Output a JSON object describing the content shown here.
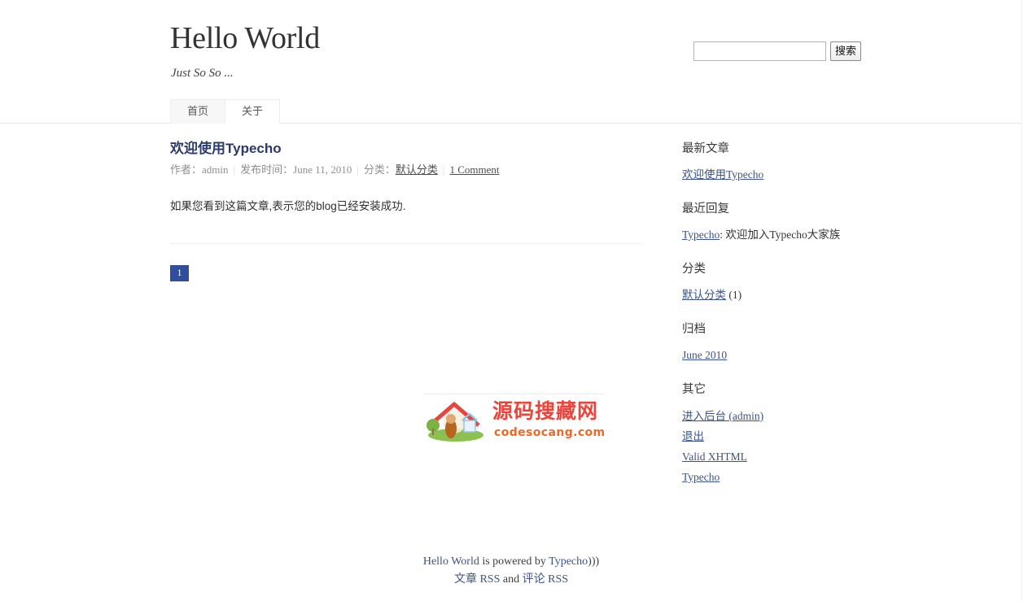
{
  "site": {
    "title": "Hello World",
    "description": "Just So So ..."
  },
  "search": {
    "value": "",
    "placeholder": "",
    "button_label": "搜索"
  },
  "nav": {
    "items": [
      {
        "label": "首页",
        "current": true
      },
      {
        "label": "关于",
        "current": false
      }
    ]
  },
  "post": {
    "title": "欢迎使用Typecho",
    "meta": {
      "author_label": "作者：",
      "author": "admin",
      "date_label": "发布时间：",
      "date": "June 11, 2010",
      "category_label": "分类：",
      "category": "默认分类",
      "comments": "1 Comment"
    },
    "body": "如果您看到这篇文章,表示您的blog已经安装成功."
  },
  "pagination": {
    "current": "1"
  },
  "sidebar": {
    "widgets": [
      {
        "title": "最新文章",
        "items": [
          {
            "link": "欢迎使用Typecho"
          }
        ]
      },
      {
        "title": "最近回复",
        "items": [
          {
            "link": "Typecho",
            "text": ": 欢迎加入Typecho大家族"
          }
        ]
      },
      {
        "title": "分类",
        "items": [
          {
            "link": "默认分类",
            "count": " (1)"
          }
        ]
      },
      {
        "title": "归档",
        "items": [
          {
            "link": "June 2010"
          }
        ]
      },
      {
        "title": "其它",
        "items": [
          {
            "link": "进入后台 (admin)"
          },
          {
            "link": "退出"
          },
          {
            "link": "Valid XHTML"
          },
          {
            "link": "Typecho"
          }
        ]
      }
    ]
  },
  "watermark": {
    "main_text": "源码搜藏网",
    "sub_text": "codesocang.com"
  },
  "footer": {
    "site_name": "Hello World",
    "powered_mid": " is powered by ",
    "engine": "Typecho",
    "suffix": ")))",
    "article_rss": "文章 RSS",
    "and": " and ",
    "comment_rss": "评论 RSS"
  },
  "colors": {
    "accent_blue": "#2f4f9e",
    "link_blue": "#3b5387",
    "title_blue": "#2b3a6b",
    "watermark_red": "#e8453c",
    "watermark_orange": "#e96a2a"
  }
}
